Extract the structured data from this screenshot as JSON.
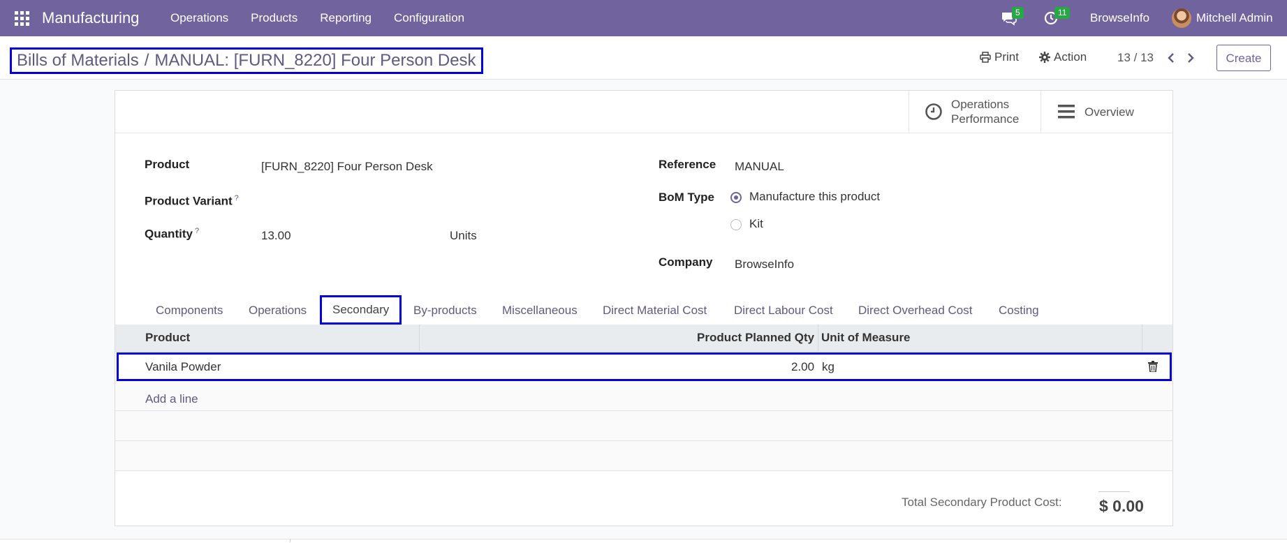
{
  "navbar": {
    "app_name": "Manufacturing",
    "menu": [
      "Operations",
      "Products",
      "Reporting",
      "Configuration"
    ],
    "messages_count": "5",
    "activities_count": "11",
    "company": "BrowseInfo",
    "user": "Mitchell Admin",
    "color": "#71639e"
  },
  "control_panel": {
    "breadcrumb_parent": "Bills of Materials",
    "breadcrumb_sep": "/",
    "breadcrumb_current": "MANUAL: [FURN_8220] Four Person Desk",
    "print_label": "Print",
    "action_label": "Action",
    "pager": "13 / 13",
    "create_label": "Create"
  },
  "smart_buttons": {
    "operations_performance_line1": "Operations",
    "operations_performance_line2": "Performance",
    "overview": "Overview"
  },
  "form": {
    "product_label": "Product",
    "product_value": "[FURN_8220] Four Person Desk",
    "variant_label": "Product Variant",
    "quantity_label": "Quantity",
    "quantity_value": "13.00",
    "uom_value": "Units",
    "help_mark": "?",
    "reference_label": "Reference",
    "reference_value": "MANUAL",
    "bom_type_label": "BoM Type",
    "bom_type_options": [
      "Manufacture this product",
      "Kit"
    ],
    "bom_type_selected": "Manufacture this product",
    "company_label": "Company",
    "company_value": "BrowseInfo"
  },
  "tabs": [
    "Components",
    "Operations",
    "Secondary",
    "By-products",
    "Miscellaneous",
    "Direct Material Cost",
    "Direct Labour Cost",
    "Direct Overhead Cost",
    "Costing"
  ],
  "active_tab": "Secondary",
  "table": {
    "columns": [
      "Product",
      "Product Planned Qty",
      "Unit of Measure"
    ],
    "rows": [
      {
        "product": "Vanila Powder",
        "qty": "2.00",
        "uom": "kg"
      }
    ],
    "add_line": "Add a line"
  },
  "totals": {
    "label": "Total Secondary Product Cost:",
    "value": "$ 0.00"
  }
}
